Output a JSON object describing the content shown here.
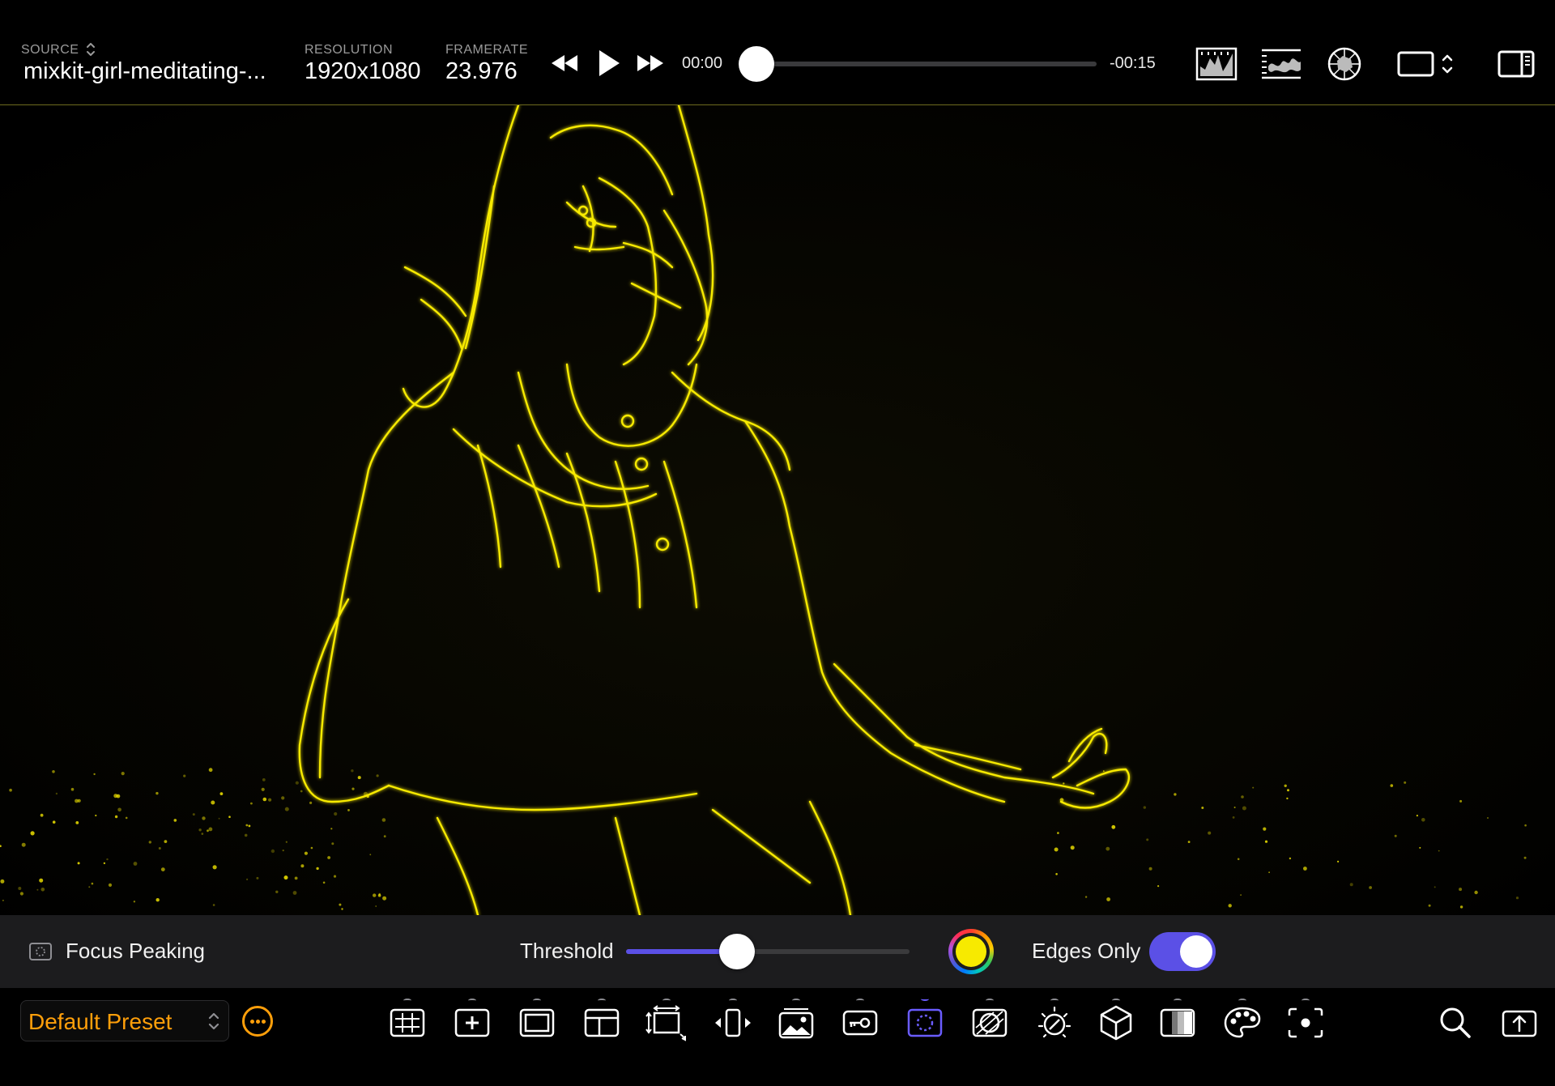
{
  "header": {
    "source_label": "SOURCE",
    "source_value": "mixkit-girl-meditating-...",
    "resolution_label": "RESOLUTION",
    "resolution_value": "1920x1080",
    "framerate_label": "FRAMERATE",
    "framerate_value": "23.976",
    "time_elapsed": "00:00",
    "time_remaining": "-00:15",
    "playhead_fraction": 0.0
  },
  "transport": {
    "icons": [
      "rewind-icon",
      "play-icon",
      "fast-forward-icon"
    ]
  },
  "scopes": {
    "icons": [
      "histogram-icon",
      "waveform-icon",
      "vectorscope-icon",
      "aspect-ratio-icon",
      "sidebar-toggle-icon"
    ]
  },
  "peaking": {
    "title": "Focus Peaking",
    "threshold_label": "Threshold",
    "threshold_fraction": 0.39,
    "peak_color": "#f7ea00",
    "edges_only_label": "Edges Only",
    "edges_only_on": true,
    "accent_color": "#5b50e6"
  },
  "toolbar": {
    "preset_label": "Default Preset",
    "tools": [
      "grid-icon",
      "crosshair-icon",
      "frame-guide-icon",
      "safe-area-icon",
      "transform-icon",
      "flip-icon",
      "image-overlay-icon",
      "key-icon",
      "focus-peaking-icon",
      "false-color-icon",
      "exposure-icon",
      "lut-cube-icon",
      "zebra-icon",
      "palette-icon",
      "spot-meter-icon"
    ],
    "active_tool": "focus-peaking-icon",
    "right_icons": [
      "search-icon",
      "export-icon"
    ]
  }
}
